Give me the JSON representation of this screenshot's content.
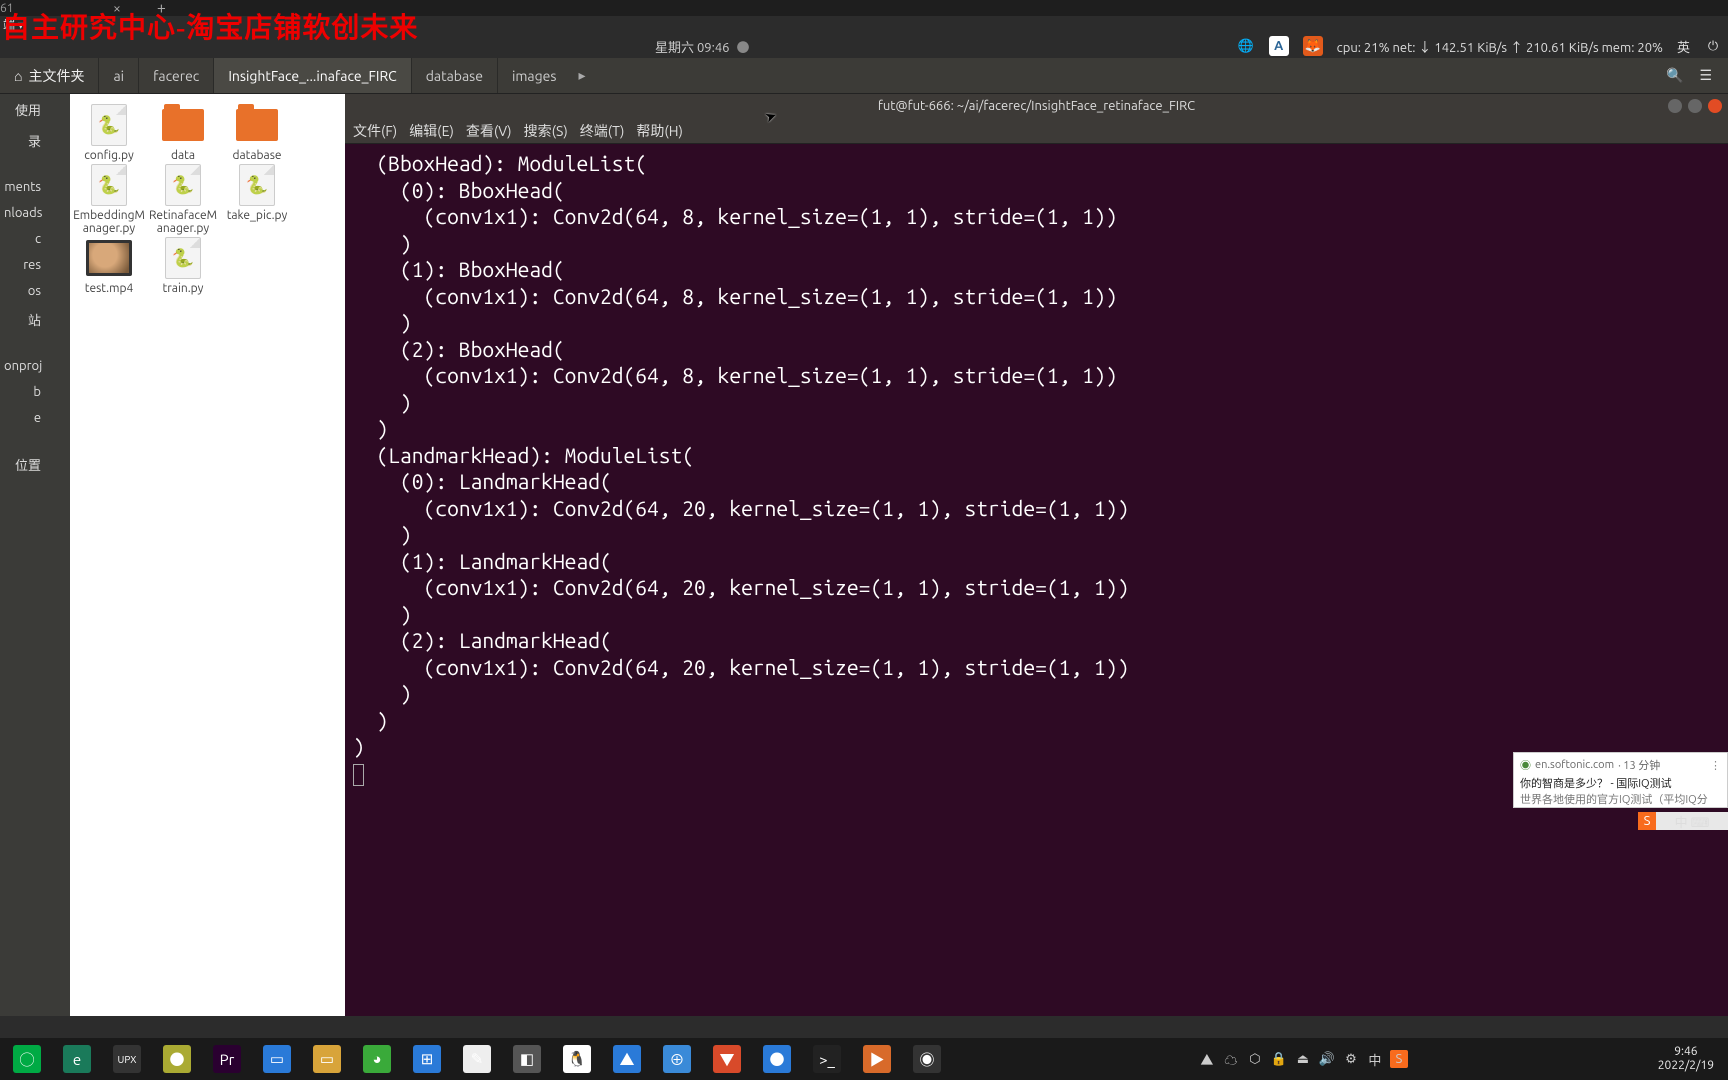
{
  "watermark": "自主研究中心-淘宝店铺软创未来",
  "remote": {
    "tab": "61",
    "close": "×",
    "plus": "+",
    "row2": "端 ▾"
  },
  "topbar": {
    "datetime": "星期六 09:46",
    "stats": "cpu: 21% net: ↓ 142.51 KiB/s ↑ 210.61 KiB/s mem: 20%",
    "lang": "英",
    "A": "A"
  },
  "breadcrumb": {
    "home": "主文件夹",
    "items": [
      "ai",
      "facerec",
      "InsightFace_...inaface_FIRC",
      "database",
      "images"
    ],
    "active_index": 2
  },
  "sidebar": {
    "items": [
      "使用",
      "录",
      "",
      "ments",
      "nloads",
      "c",
      "res",
      "os",
      "站",
      "",
      "onproj",
      "b",
      "e",
      "",
      "位置"
    ]
  },
  "files": [
    {
      "name": "config.py",
      "type": "py"
    },
    {
      "name": "data",
      "type": "folder"
    },
    {
      "name": "database",
      "type": "folder"
    },
    {
      "name": "EmbeddingManager.py",
      "type": "py"
    },
    {
      "name": "RetinafaceManager.py",
      "type": "py"
    },
    {
      "name": "take_pic.py",
      "type": "py"
    },
    {
      "name": "test.mp4",
      "type": "video"
    },
    {
      "name": "train.py",
      "type": "py"
    }
  ],
  "terminal": {
    "title": "fut@fut-666: ~/ai/facerec/InsightFace_retinaface_FIRC",
    "menus": [
      "文件(F)",
      "编辑(E)",
      "查看(V)",
      "搜索(S)",
      "终端(T)",
      "帮助(H)"
    ],
    "lines": [
      "  (BboxHead): ModuleList(",
      "    (0): BboxHead(",
      "      (conv1x1): Conv2d(64, 8, kernel_size=(1, 1), stride=(1, 1))",
      "    )",
      "    (1): BboxHead(",
      "      (conv1x1): Conv2d(64, 8, kernel_size=(1, 1), stride=(1, 1))",
      "    )",
      "    (2): BboxHead(",
      "      (conv1x1): Conv2d(64, 8, kernel_size=(1, 1), stride=(1, 1))",
      "    )",
      "  )",
      "  (LandmarkHead): ModuleList(",
      "    (0): LandmarkHead(",
      "      (conv1x1): Conv2d(64, 20, kernel_size=(1, 1), stride=(1, 1))",
      "    )",
      "    (1): LandmarkHead(",
      "      (conv1x1): Conv2d(64, 20, kernel_size=(1, 1), stride=(1, 1))",
      "    )",
      "    (2): LandmarkHead(",
      "      (conv1x1): Conv2d(64, 20, kernel_size=(1, 1), stride=(1, 1))",
      "    )",
      "  )",
      ")"
    ]
  },
  "notification": {
    "site": "en.softonic.com",
    "time": "· 13 分钟",
    "line1": "你的智商是多少？ - 国际IQ测试",
    "line2": "世界各地使用的官方IQ测试（平均IQ分"
  },
  "ime": {
    "s": "S",
    "zh": "中 ⌨"
  },
  "taskbar": {
    "apps": [
      {
        "name": "start",
        "bg": "#0a4",
        "glyph": "◯"
      },
      {
        "name": "edge",
        "bg": "#1a7a5a",
        "glyph": "e"
      },
      {
        "name": "upx",
        "bg": "#333",
        "glyph": "UPX"
      },
      {
        "name": "app4",
        "bg": "#aa3",
        "glyph": "●"
      },
      {
        "name": "premiere",
        "bg": "#2a0030",
        "glyph": "Pr"
      },
      {
        "name": "notes",
        "bg": "#2a7ad8",
        "glyph": "▭"
      },
      {
        "name": "explorer",
        "bg": "#d8a43a",
        "glyph": "▭"
      },
      {
        "name": "wechat",
        "bg": "#3aaa3a",
        "glyph": "◕"
      },
      {
        "name": "grid",
        "bg": "#2a7ad8",
        "glyph": "⊞"
      },
      {
        "name": "notepad",
        "bg": "#eee",
        "glyph": "✎"
      },
      {
        "name": "snip",
        "bg": "#555",
        "glyph": "◧"
      },
      {
        "name": "qq",
        "bg": "#fff",
        "glyph": "🐧"
      },
      {
        "name": "feishu",
        "bg": "#2a7ad8",
        "glyph": "▲"
      },
      {
        "name": "app14",
        "bg": "#3a8ad8",
        "glyph": "⊕"
      },
      {
        "name": "app15",
        "bg": "#d84a2a",
        "glyph": "▼"
      },
      {
        "name": "app16",
        "bg": "#2a7ad8",
        "glyph": "●"
      },
      {
        "name": "terminal",
        "bg": "#222",
        "glyph": ">_"
      },
      {
        "name": "app18",
        "bg": "#d86a2a",
        "glyph": "▶"
      },
      {
        "name": "obs",
        "bg": "#333",
        "glyph": "◉"
      }
    ],
    "tray": [
      "▲",
      "☁",
      "⬡",
      "🔒",
      "⏏",
      "🔊",
      "⚙",
      "中"
    ],
    "tray_s": "S",
    "clock_time": "9:46",
    "clock_date": "2022/2/19"
  }
}
